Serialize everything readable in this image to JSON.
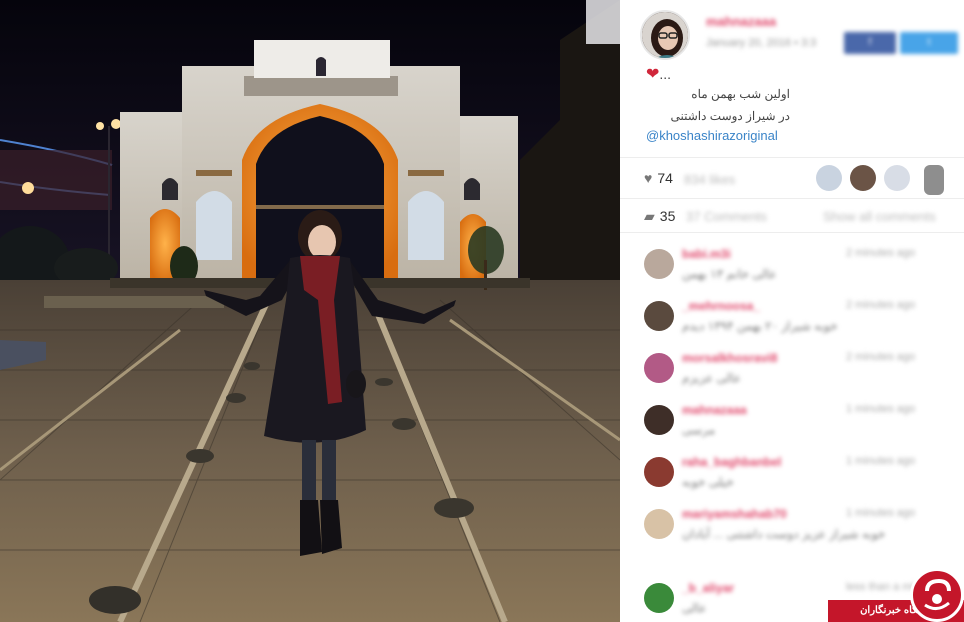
{
  "post": {
    "owner": "mahnazaaa",
    "date": "January 20, 2016 • 3:3"
  },
  "share": {
    "facebook": "f",
    "twitter": "t"
  },
  "caption": {
    "heart": "...",
    "line1": "اولین شب بهمن ماه",
    "line2": "در شیراز دوست داشتنی",
    "mention": "@khoshashirazoriginal"
  },
  "stats": {
    "likes_count": "74",
    "likes_label": "834 likes",
    "comments_count": "35",
    "comments_label": "37 Comments",
    "show_all": "Show all comments"
  },
  "comments": [
    {
      "user": "babi.m3i",
      "time": "2 minutes ago",
      "text": "عالی خانم ۱۳ بهمن"
    },
    {
      "user": "_mehrnoosa_",
      "time": "2 minutes ago",
      "text": "خوبه شیراز ۲۰ بهمن ۱۳۹۴ دیدم"
    },
    {
      "user": "morsalkhosravi8",
      "time": "2 minutes ago",
      "text": "عالی عزیزم"
    },
    {
      "user": "mahnazaaa",
      "time": "1 minutes ago",
      "text": "مرسی"
    },
    {
      "user": "raha_baghbanbel",
      "time": "1 minutes ago",
      "text": "خیلی خوبه"
    },
    {
      "user": "mariyamshahab70",
      "time": "1 minutes ago",
      "text": "خوبه شیراز عزیز دوست داشتنی ... آبادان"
    },
    {
      "user": "_b_aliyar",
      "time": "less than a minute ago",
      "text": "عالی"
    }
  ],
  "watermark": {
    "text": "باشگاه خبرنگاران"
  },
  "colors": {
    "username": "#e0476b",
    "mention": "#3a84c8",
    "watermark": "#c4162a",
    "facebook": "#4a68aa",
    "twitter": "#48a4e8"
  },
  "icons": {
    "likes": "heart-icon",
    "comments": "comment-bubble-icon",
    "caption": "red-heart-icon"
  }
}
